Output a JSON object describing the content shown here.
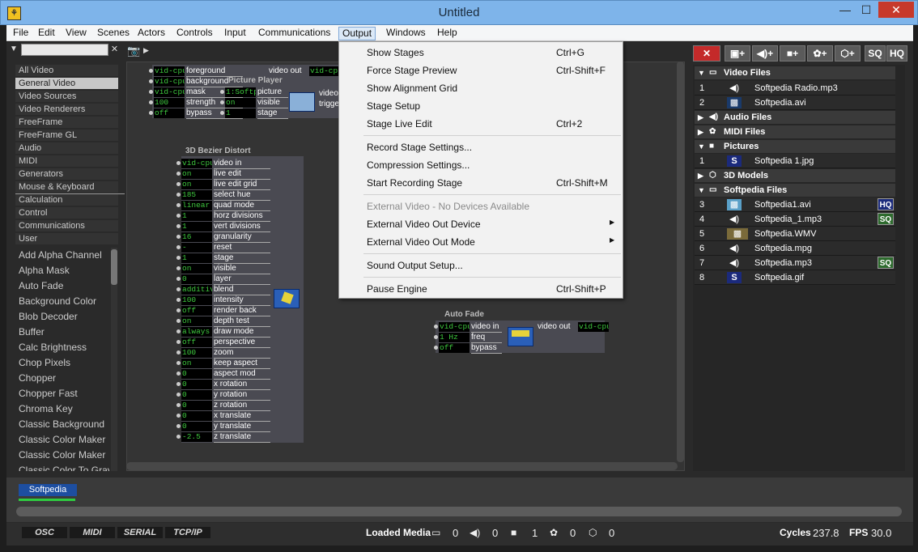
{
  "window": {
    "title": "Untitled",
    "min": "—",
    "max": "☐",
    "close": "✕",
    "app_icon": "⚘"
  },
  "menu": [
    "File",
    "Edit",
    "View",
    "Scenes",
    "Actors",
    "Controls",
    "Input",
    "Communications",
    "Output",
    "Windows",
    "Help"
  ],
  "output_menu": {
    "items": [
      {
        "label": "Show Stages",
        "shortcut": "Ctrl+G"
      },
      {
        "label": "Force Stage Preview",
        "shortcut": "Ctrl-Shift+F"
      },
      {
        "label": "Show Alignment Grid",
        "shortcut": ""
      },
      {
        "label": "Stage Setup",
        "shortcut": ""
      },
      {
        "label": "Stage Live Edit",
        "shortcut": "Ctrl+2"
      },
      {
        "label": "Record Stage Settings...",
        "shortcut": ""
      },
      {
        "label": "Compression Settings...",
        "shortcut": ""
      },
      {
        "label": "Start Recording Stage",
        "shortcut": "Ctrl-Shift+M"
      },
      {
        "label": "External Video - No Devices Available",
        "shortcut": ""
      },
      {
        "label": "External Video Out Device",
        "shortcut": ""
      },
      {
        "label": "External Video Out Mode",
        "shortcut": ""
      },
      {
        "label": "Sound Output Setup...",
        "shortcut": ""
      },
      {
        "label": "Pause Engine",
        "shortcut": "Ctrl-Shift+P"
      }
    ],
    "submenu_arrow": "▶"
  },
  "left_panel": {
    "filter_icon": "▼",
    "clear": "✕",
    "categories": [
      "All Video",
      "General Video",
      "Video Sources",
      "Video Renderers",
      "FreeFrame",
      "FreeFrame GL",
      "Audio",
      "MIDI",
      "Generators",
      "Mouse & Keyboard",
      "Calculation",
      "Control",
      "Communications",
      "User"
    ],
    "actors": [
      "Add Alpha Channel",
      "Alpha Mask",
      "Auto Fade",
      "Background Color",
      "Blob Decoder",
      "Buffer",
      "Calc Brightness",
      "Chop Pixels",
      "Chopper",
      "Chopper Fast",
      "Chroma Key",
      "Classic Background",
      "Classic Color Maker",
      "Classic Color Maker",
      "Classic Color To Gray"
    ]
  },
  "stage_toolbar": {
    "camera": "📷",
    "arrow": "▶"
  },
  "top_node": {
    "title": "Picture Player",
    "left_rows": [
      {
        "v": "vid-cpu",
        "l": "foreground"
      },
      {
        "v": "vid-cpu",
        "l": "background"
      },
      {
        "v": "vid-cpu",
        "l": "mask"
      },
      {
        "v": "100",
        "l": "strength"
      },
      {
        "v": "off",
        "l": "bypass"
      }
    ],
    "right_rows": [
      {
        "v": "1:Softp",
        "l": "picture"
      },
      {
        "v": "on",
        "l": "visible"
      },
      {
        "v": "1",
        "l": "stage"
      }
    ],
    "out_label": "video out",
    "out_value": "vid-cpu",
    "trig": "trigger",
    "vid": "video"
  },
  "bezier_node": {
    "title": "3D Bezier Distort",
    "rows": [
      {
        "v": "vid-cpu",
        "l": "video in"
      },
      {
        "v": "on",
        "l": "live edit"
      },
      {
        "v": "on",
        "l": "live edit grid"
      },
      {
        "v": "185",
        "l": "select hue"
      },
      {
        "v": "linear",
        "l": "quad mode"
      },
      {
        "v": "1",
        "l": "horz divisions"
      },
      {
        "v": "1",
        "l": "vert divisions"
      },
      {
        "v": "16",
        "l": "granularity"
      },
      {
        "v": "-",
        "l": "reset"
      },
      {
        "v": "1",
        "l": "stage"
      },
      {
        "v": "on",
        "l": "visible"
      },
      {
        "v": "0",
        "l": "layer"
      },
      {
        "v": "additive",
        "l": "blend"
      },
      {
        "v": "100",
        "l": "intensity"
      },
      {
        "v": "off",
        "l": "render back"
      },
      {
        "v": "on",
        "l": "depth test"
      },
      {
        "v": "always",
        "l": "draw mode"
      },
      {
        "v": "off",
        "l": "perspective"
      },
      {
        "v": "100",
        "l": "zoom"
      },
      {
        "v": "on",
        "l": "keep aspect"
      },
      {
        "v": "0",
        "l": "aspect mod"
      },
      {
        "v": "0",
        "l": "x rotation"
      },
      {
        "v": "0",
        "l": "y rotation"
      },
      {
        "v": "0",
        "l": "z rotation"
      },
      {
        "v": "0",
        "l": "x translate"
      },
      {
        "v": "0",
        "l": "y translate"
      },
      {
        "v": "-2.5",
        "l": "z translate"
      }
    ]
  },
  "autofade_node": {
    "title": "Auto Fade",
    "rows": [
      {
        "v": "vid-cpu",
        "l": "video in"
      },
      {
        "v": "1 Hz",
        "l": "freq"
      },
      {
        "v": "off",
        "l": "bypass"
      }
    ],
    "out_label": "video out",
    "out_value": "vid-cpu"
  },
  "media_toolbar": [
    "✕",
    "▣+",
    "◀)+",
    "■+",
    "✿+",
    "⬡+",
    "SQ",
    "HQ"
  ],
  "media": {
    "groups": [
      {
        "name": "Video Files",
        "expanded": "▼",
        "icon": "▭",
        "files": [
          {
            "n": "1",
            "icon": "◀)",
            "name": "Softpedia Radio.mp3",
            "badge": ""
          },
          {
            "n": "2",
            "icon": "▩",
            "name": "Softpedia.avi",
            "badge": ""
          }
        ]
      },
      {
        "name": "Audio Files",
        "expanded": "▶",
        "icon": "◀)",
        "files": []
      },
      {
        "name": "MIDI Files",
        "expanded": "▶",
        "icon": "✿",
        "files": []
      },
      {
        "name": "Pictures",
        "expanded": "▼",
        "icon": "■",
        "files": [
          {
            "n": "1",
            "icon": "S",
            "name": "Softpedia 1.jpg",
            "badge": ""
          }
        ]
      },
      {
        "name": "3D Models",
        "expanded": "▶",
        "icon": "⬡",
        "files": []
      },
      {
        "name": "Softpedia Files",
        "expanded": "▼",
        "icon": "▭",
        "files": [
          {
            "n": "3",
            "icon": "▩",
            "name": "Softpedia1.avi",
            "badge": "HQ"
          },
          {
            "n": "4",
            "icon": "◀)",
            "name": "Softpedia_1.mp3",
            "badge": "SQ"
          },
          {
            "n": "5",
            "icon": "▩",
            "name": "Softpedia.WMV",
            "badge": ""
          },
          {
            "n": "6",
            "icon": "◀)",
            "name": "Softpedia.mpg",
            "badge": ""
          },
          {
            "n": "7",
            "icon": "◀)",
            "name": "Softpedia.mp3",
            "badge": "SQ"
          },
          {
            "n": "8",
            "icon": "S",
            "name": "Softpedia.gif",
            "badge": ""
          }
        ]
      }
    ]
  },
  "scenes": {
    "current": "Softpedia"
  },
  "protocols": [
    "OSC",
    "MIDI",
    "SERIAL",
    "TCP/IP"
  ],
  "status": {
    "loaded_label": "Loaded Media",
    "video_count": "0",
    "audio_count": "0",
    "pic_count": "1",
    "midi_count": "0",
    "model_count": "0",
    "cycles_label": "Cycles",
    "cycles": "237.8",
    "fps_label": "FPS",
    "fps": "30.0"
  }
}
